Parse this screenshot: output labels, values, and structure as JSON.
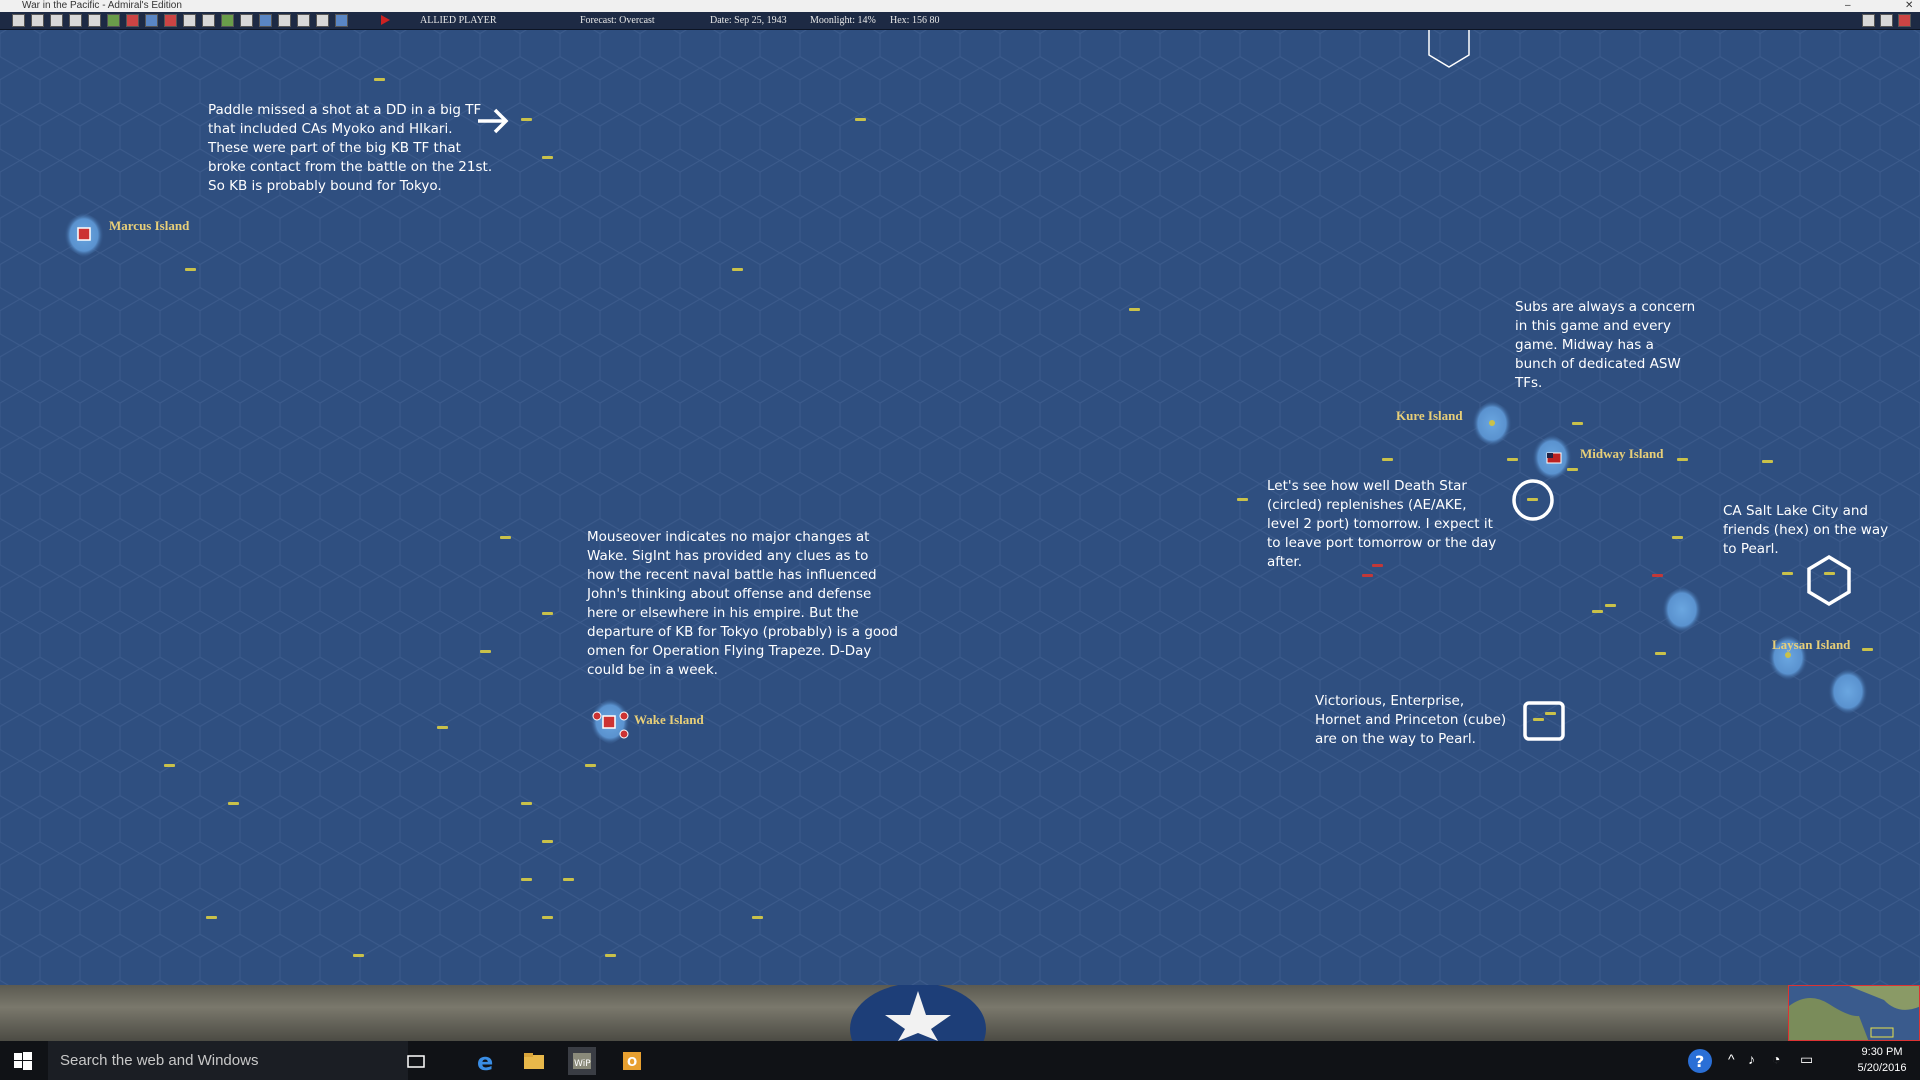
{
  "window": {
    "title": "War in the Pacific - Admiral's Edition"
  },
  "toolbar": {
    "side": "ALLIED PLAYER",
    "forecast": "Forecast: Overcast",
    "date": "Date: Sep 25, 1943",
    "moonlight": "Moonlight: 14%",
    "hex": "Hex: 156 80"
  },
  "islands": {
    "marcus": "Marcus Island",
    "kure": "Kure Island",
    "midway": "Midway Island",
    "laysan": "Laysan Island",
    "wake": "Wake Island"
  },
  "notes": {
    "paddle": "Paddle missed a shot at a DD in a big TF\nthat included CAs Myoko and HIkari.\nThese were part of the big KB TF that\nbroke contact from the battle on the 21st.\nSo KB is probably bound for Tokyo.",
    "subs": "Subs are always a concern\nin this game and every\ngame.  Midway has a\nbunch of dedicated ASW\nTFs.",
    "deathstar": "Let's see how well Death Star\n(circled)  replenishes (AE/AKE,\nlevel 2 port) tomorrow.  I expect it\nto leave port tomorrow or the day\nafter.",
    "saltlake": "CA Salt Lake City and\nfriends (hex) on the way\nto Pearl.",
    "wake": "Mouseover indicates no major changes at\nWake.  SigInt has provided any clues as to\nhow the recent naval battle has influenced\nJohn's thinking about offense and defense\nhere or elsewhere in his empire.  But the\ndeparture of KB for Tokyo (probably) is a good\nomen for Operation Flying Trapeze.  D-Day\ncould be in a week.",
    "carriers": "Victorious, Enterprise,\nHornet and Princeton (cube)\nare on the way to Pearl."
  },
  "taskbar": {
    "search_placeholder": "Search the web and Windows",
    "time": "9:30 PM",
    "date": "5/20/2016"
  },
  "icons": {
    "arrow": "arrow-right-icon",
    "start": "windows-start-icon",
    "task_view": "task-view-icon",
    "edge": "edge-icon",
    "explorer": "file-explorer-icon",
    "game": "game-app-icon",
    "outlook": "outlook-icon",
    "help": "help-icon"
  },
  "colors": {
    "sea": "#2f4f80",
    "island_glow": "#5f9ad6",
    "label_gold": "#e8cf78",
    "ship_yellow": "#c9c14a"
  }
}
